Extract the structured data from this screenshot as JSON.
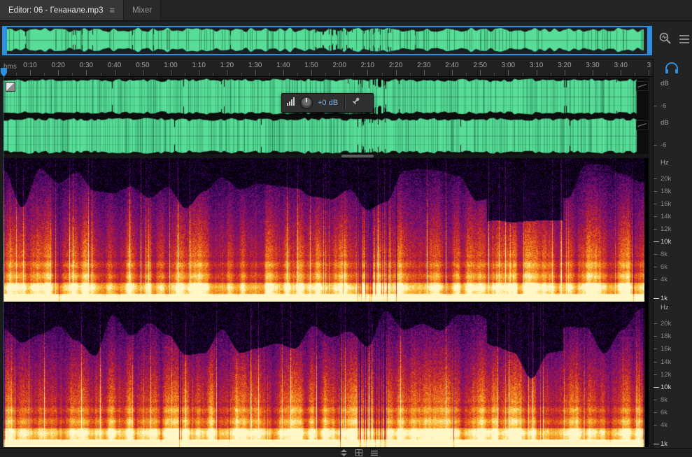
{
  "panel_tabs": {
    "editor_label": "Editor: 06 - Генанале.mp3",
    "menu_icon": "≡",
    "mixer_label": "Mixer"
  },
  "ruler": {
    "unit_label": "hms",
    "ticks": [
      "0:10",
      "0:20",
      "0:30",
      "0:40",
      "0:50",
      "1:00",
      "1:10",
      "1:20",
      "1:30",
      "1:40",
      "1:50",
      "2:00",
      "2:10",
      "2:20",
      "2:30",
      "2:40",
      "2:50",
      "3:00",
      "3:10",
      "3:20",
      "3:30",
      "3:40"
    ],
    "edge_label": "3"
  },
  "hud": {
    "gain_label": "+0 dB"
  },
  "waveform": {
    "unit": "dB",
    "tick_label": "-6"
  },
  "spectral": {
    "unit": "Hz",
    "freq_labels": [
      {
        "label": "20k",
        "freq": 20000,
        "strong": false
      },
      {
        "label": "18k",
        "freq": 18000,
        "strong": false
      },
      {
        "label": "16k",
        "freq": 16000,
        "strong": false
      },
      {
        "label": "14k",
        "freq": 14000,
        "strong": false
      },
      {
        "label": "12k",
        "freq": 12000,
        "strong": false
      },
      {
        "label": "10k",
        "freq": 10000,
        "strong": true
      },
      {
        "label": "8k",
        "freq": 8000,
        "strong": false
      },
      {
        "label": "6k",
        "freq": 6000,
        "strong": false
      },
      {
        "label": "4k",
        "freq": 4000,
        "strong": false
      },
      {
        "label": "1k",
        "freq": 1000,
        "strong": true
      }
    ]
  },
  "colors": {
    "accent_blue": "#2e8fe0",
    "waveform_green": "#57dd97",
    "waveform_green_dark": "#1f8a55",
    "spectral_stops": [
      {
        "p": 0.0,
        "c": "#000000"
      },
      {
        "p": 0.1,
        "c": "#16002c"
      },
      {
        "p": 0.22,
        "c": "#3c0560"
      },
      {
        "p": 0.35,
        "c": "#6e0f78"
      },
      {
        "p": 0.48,
        "c": "#9c1450"
      },
      {
        "p": 0.6,
        "c": "#cd2d23"
      },
      {
        "p": 0.72,
        "c": "#eb6a19"
      },
      {
        "p": 0.84,
        "c": "#f8b02d"
      },
      {
        "p": 0.93,
        "c": "#fcd96a"
      },
      {
        "p": 1.0,
        "c": "#fff7c8"
      }
    ]
  }
}
